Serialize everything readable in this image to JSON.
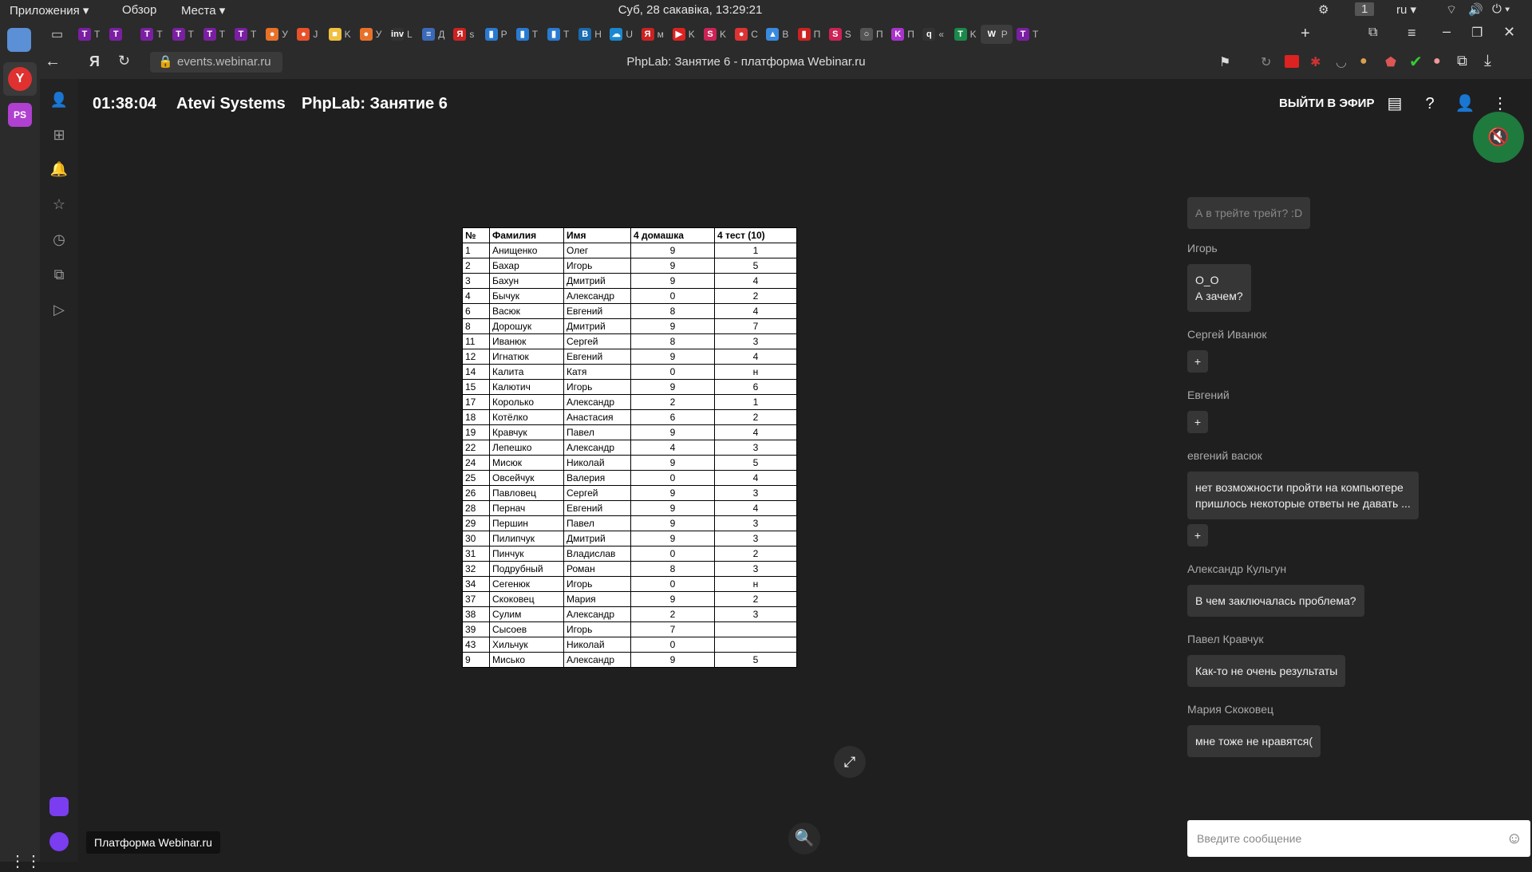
{
  "system_bar": {
    "menus": [
      "Приложения ▾",
      "Обзор",
      "Места ▾"
    ],
    "clock": "Суб, 28 сакавіка, 13:29:21",
    "workspace": "1",
    "lang": "ru ▾"
  },
  "browser": {
    "tabs": [
      {
        "icon": "T",
        "label": "Т",
        "color": "#7a1fa2"
      },
      {
        "icon": "T",
        "label": "",
        "color": "#7a1fa2"
      },
      {
        "icon": "T",
        "label": "Т",
        "color": "#7a1fa2"
      },
      {
        "icon": "T",
        "label": "Т",
        "color": "#7a1fa2"
      },
      {
        "icon": "T",
        "label": "Т",
        "color": "#7a1fa2"
      },
      {
        "icon": "T",
        "label": "Т",
        "color": "#7a1fa2"
      },
      {
        "icon": "●",
        "label": "У",
        "color": "#e8712a"
      },
      {
        "icon": "●",
        "label": "J",
        "color": "#e8512a"
      },
      {
        "icon": "■",
        "label": "K",
        "color": "#f0c040"
      },
      {
        "icon": "●",
        "label": "У",
        "color": "#e8712a"
      },
      {
        "icon": "inv",
        "label": "L",
        "color": "#333333"
      },
      {
        "icon": "≡",
        "label": "Д",
        "color": "#3a6ab8"
      },
      {
        "icon": "Я",
        "label": "s",
        "color": "#cc2222"
      },
      {
        "icon": "▮",
        "label": "P",
        "color": "#2a7ad0"
      },
      {
        "icon": "▮",
        "label": "T",
        "color": "#2a7ad0"
      },
      {
        "icon": "▮",
        "label": "T",
        "color": "#2a7ad0"
      },
      {
        "icon": "B",
        "label": "H",
        "color": "#1a6ab0"
      },
      {
        "icon": "☁",
        "label": "U",
        "color": "#1a88d0"
      },
      {
        "icon": "Я",
        "label": "м",
        "color": "#cc2222"
      },
      {
        "icon": "▶",
        "label": "K",
        "color": "#dd2222"
      },
      {
        "icon": "S",
        "label": "K",
        "color": "#cc2255"
      },
      {
        "icon": "●",
        "label": "С",
        "color": "#dd3333"
      },
      {
        "icon": "▲",
        "label": "B",
        "color": "#3a8ae0"
      },
      {
        "icon": "▮",
        "label": "П",
        "color": "#cc2222"
      },
      {
        "icon": "S",
        "label": "S",
        "color": "#cc2255"
      },
      {
        "icon": "○",
        "label": "П",
        "color": "#555555"
      },
      {
        "icon": "K",
        "label": "П",
        "color": "#aa33cc"
      },
      {
        "icon": "q",
        "label": "«",
        "color": "#333333"
      },
      {
        "icon": "T",
        "label": "K",
        "color": "#1a8a4a"
      },
      {
        "icon": "W",
        "label": "P",
        "color": "#3d3d3d"
      },
      {
        "icon": "T",
        "label": "T",
        "color": "#7a1fa2"
      }
    ],
    "url": "events.webinar.ru",
    "page_title": "PhpLab: Занятие 6 - платформа Webinar.ru"
  },
  "webinar": {
    "timer": "01:38:04",
    "organizer": "Atevi Systems",
    "title": "PhpLab: Занятие 6",
    "go_live": "ВЫЙТИ В ЭФИР"
  },
  "table": {
    "headers": [
      "№",
      "Фамилия",
      "Имя",
      "4 домашка",
      "4 тест (10)"
    ],
    "rows": [
      [
        "1",
        "Анищенко",
        "Олег",
        "9",
        "1"
      ],
      [
        "2",
        "Бахар",
        "Игорь",
        "9",
        "5"
      ],
      [
        "3",
        "Бахун",
        "Дмитрий",
        "9",
        "4"
      ],
      [
        "4",
        "Бычук",
        "Александр",
        "0",
        "2"
      ],
      [
        "6",
        "Васюк",
        "Евгений",
        "8",
        "4"
      ],
      [
        "8",
        "Дорошук",
        "Дмитрий",
        "9",
        "7"
      ],
      [
        "11",
        "Иванюк",
        "Сергей",
        "8",
        "3"
      ],
      [
        "12",
        "Игнатюк",
        "Евгений",
        "9",
        "4"
      ],
      [
        "14",
        "Калита",
        "Катя",
        "0",
        "н"
      ],
      [
        "15",
        "Калютич",
        "Игорь",
        "9",
        "6"
      ],
      [
        "17",
        "Королько",
        "Александр",
        "2",
        "1"
      ],
      [
        "18",
        "Котёлко",
        "Анастасия",
        "6",
        "2"
      ],
      [
        "19",
        "Кравчук",
        "Павел",
        "9",
        "4"
      ],
      [
        "22",
        "Лепешко",
        "Александр",
        "4",
        "3"
      ],
      [
        "24",
        "Мисюк",
        "Николай",
        "9",
        "5"
      ],
      [
        "25",
        "Овсейчук",
        "Валерия",
        "0",
        "4"
      ],
      [
        "26",
        "Павловец",
        "Сергей",
        "9",
        "3"
      ],
      [
        "28",
        "Пернач",
        "Евгений",
        "9",
        "4"
      ],
      [
        "29",
        "Першин",
        "Павел",
        "9",
        "3"
      ],
      [
        "30",
        "Пилипчук",
        "Дмитрий",
        "9",
        "3"
      ],
      [
        "31",
        "Пинчук",
        "Владислав",
        "0",
        "2"
      ],
      [
        "32",
        "Подрубный",
        "Роман",
        "8",
        "3"
      ],
      [
        "34",
        "Сегенюк",
        "Игорь",
        "0",
        "н"
      ],
      [
        "37",
        "Скоковец",
        "Мария",
        "9",
        "2"
      ],
      [
        "38",
        "Сулим",
        "Александр",
        "2",
        "3"
      ],
      [
        "39",
        "Сысоев",
        "Игорь",
        "7",
        ""
      ],
      [
        "43",
        "Хильчук",
        "Николай",
        "0",
        ""
      ],
      [
        "9",
        "Мисько",
        "Александр",
        "9",
        "5"
      ]
    ]
  },
  "chat": {
    "faded_message": "А в трейте трейт? :D",
    "author_1": "Игорь",
    "msg_1_line1": "О_О",
    "msg_1_line2": "А зачем?",
    "author_2": "Сергей Иванюк",
    "plus": "+",
    "author_3": "Евгений",
    "author_4": "евгений васюк",
    "msg_4_line1": "нет возможности пройти на компьютере",
    "msg_4_line2": "пришлось некоторые ответы не давать ...",
    "author_5": "Александр Кульгун",
    "msg_5": "В чем заключалась проблема?",
    "author_6": "Павел Кравчук",
    "msg_6": "Как-то не очень результаты",
    "author_7": "Мария Скоковец",
    "msg_7": "мне тоже не нравятся(",
    "input_placeholder": "Введите сообщение"
  },
  "tooltip": "Платформа Webinar.ru",
  "icons": {
    "mute": "mic-off-icon",
    "chat": "chat-icon",
    "help": "help-icon",
    "user": "user-icon",
    "more": "more-vertical-icon"
  },
  "colors": {
    "accent_green": "#1f7a3d",
    "background": "#1f1f1f"
  }
}
